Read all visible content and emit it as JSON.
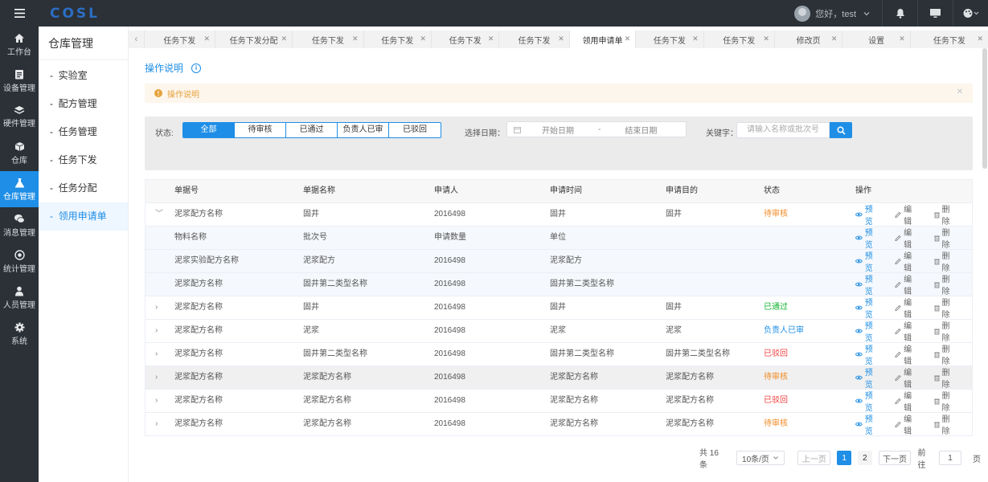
{
  "brand": {
    "logo": "COSL",
    "logo_color": "#2b6ec4",
    "accent": "#1e8ee6"
  },
  "header": {
    "greeting": "您好，test"
  },
  "leftnav": [
    {
      "label": "工作台",
      "icon": "home-icon"
    },
    {
      "label": "设备管理",
      "icon": "clipboard-icon"
    },
    {
      "label": "硬件管理",
      "icon": "layers-icon"
    },
    {
      "label": "仓库",
      "icon": "box-icon"
    },
    {
      "label": "仓库管理",
      "icon": "flask-icon",
      "active": true
    },
    {
      "label": "消息管理",
      "icon": "chat-icon"
    },
    {
      "label": "统计管理",
      "icon": "target-icon"
    },
    {
      "label": "人员管理",
      "icon": "user-icon"
    },
    {
      "label": "系统",
      "icon": "gear-icon"
    }
  ],
  "subnav": {
    "title": "仓库管理",
    "items": [
      {
        "label": "实验室"
      },
      {
        "label": "配方管理"
      },
      {
        "label": "任务管理"
      },
      {
        "label": "任务下发"
      },
      {
        "label": "任务分配"
      },
      {
        "label": "领用申请单",
        "active": true
      }
    ]
  },
  "tabs": [
    {
      "label": "任务下发"
    },
    {
      "label": "任务下发分配"
    },
    {
      "label": "任务下发"
    },
    {
      "label": "任务下发"
    },
    {
      "label": "任务下发"
    },
    {
      "label": "任务下发"
    },
    {
      "label": "领用申请单",
      "active": true
    },
    {
      "label": "任务下发"
    },
    {
      "label": "任务下发"
    },
    {
      "label": "修改页"
    },
    {
      "label": "设置"
    },
    {
      "label": "任务下发"
    }
  ],
  "main": {
    "guide_title": "操作说明",
    "alert_text": "操作说明",
    "filter": {
      "status_label": "状态:",
      "status_options": [
        "全部",
        "待审核",
        "已通过",
        "负责人已审",
        "已驳回"
      ],
      "selected": "全部",
      "date_label": "选择日期：",
      "date_start_placeholder": "开始日期",
      "date_sep": "-",
      "date_end_placeholder": "结束日期",
      "keyword_label": "关键字：",
      "keyword_placeholder": "请输入名称或批次号"
    },
    "table": {
      "headers": [
        "单据号",
        "单据名称",
        "申请人",
        "申请时间",
        "申请目的",
        "状态",
        "操作"
      ],
      "actions": {
        "view": "预览",
        "edit": "编辑",
        "delete": "删除"
      },
      "rows": [
        {
          "kind": "main",
          "expanded": true,
          "cells": [
            "泥浆配方名称",
            "固井",
            "2016498",
            "固井",
            "固井"
          ],
          "status": "待审核",
          "status_type": "wait"
        },
        {
          "kind": "sub",
          "cells": [
            "物料名称",
            "批次号",
            "申请数量",
            "单位",
            ""
          ]
        },
        {
          "kind": "sub",
          "cells": [
            "泥浆实验配方名称",
            "泥浆配方",
            "2016498",
            "泥浆配方",
            ""
          ]
        },
        {
          "kind": "sub",
          "cells": [
            "泥浆配方名称",
            "固井第二类型名称",
            "2016498",
            "固井第二类型名称",
            ""
          ]
        },
        {
          "kind": "main",
          "cells": [
            "泥浆配方名称",
            "固井",
            "2016498",
            "固井",
            "固井"
          ],
          "status": "已通过",
          "status_type": "pass"
        },
        {
          "kind": "main",
          "cells": [
            "泥浆配方名称",
            "泥浆",
            "2016498",
            "泥浆",
            "泥浆"
          ],
          "status": "负责人已审",
          "status_type": "leader"
        },
        {
          "kind": "main",
          "cells": [
            "泥浆配方名称",
            "固井第二类型名称",
            "2016498",
            "固井第二类型名称",
            "固井第二类型名称"
          ],
          "status": "已驳回",
          "status_type": "rej"
        },
        {
          "kind": "main",
          "highlight": true,
          "cells": [
            "泥浆配方名称",
            "泥浆配方名称",
            "2016498",
            "泥浆配方名称",
            "泥浆配方名称"
          ],
          "status": "待审核",
          "status_type": "wait"
        },
        {
          "kind": "main",
          "cells": [
            "泥浆配方名称",
            "泥浆配方名称",
            "2016498",
            "泥浆配方名称",
            "泥浆配方名称"
          ],
          "status": "已驳回",
          "status_type": "rej"
        },
        {
          "kind": "main",
          "cells": [
            "泥浆配方名称",
            "泥浆配方名称",
            "2016498",
            "泥浆配方名称",
            "泥浆配方名称"
          ],
          "status": "待审核",
          "status_type": "wait"
        }
      ]
    },
    "pagination": {
      "total": "共 16 条",
      "page_size": "10条/页",
      "prev": "上一页",
      "pages": [
        "1",
        "2"
      ],
      "current": "1",
      "next": "下一页",
      "goto_label": "前往",
      "goto_value": "1",
      "goto_suffix": "页"
    }
  }
}
